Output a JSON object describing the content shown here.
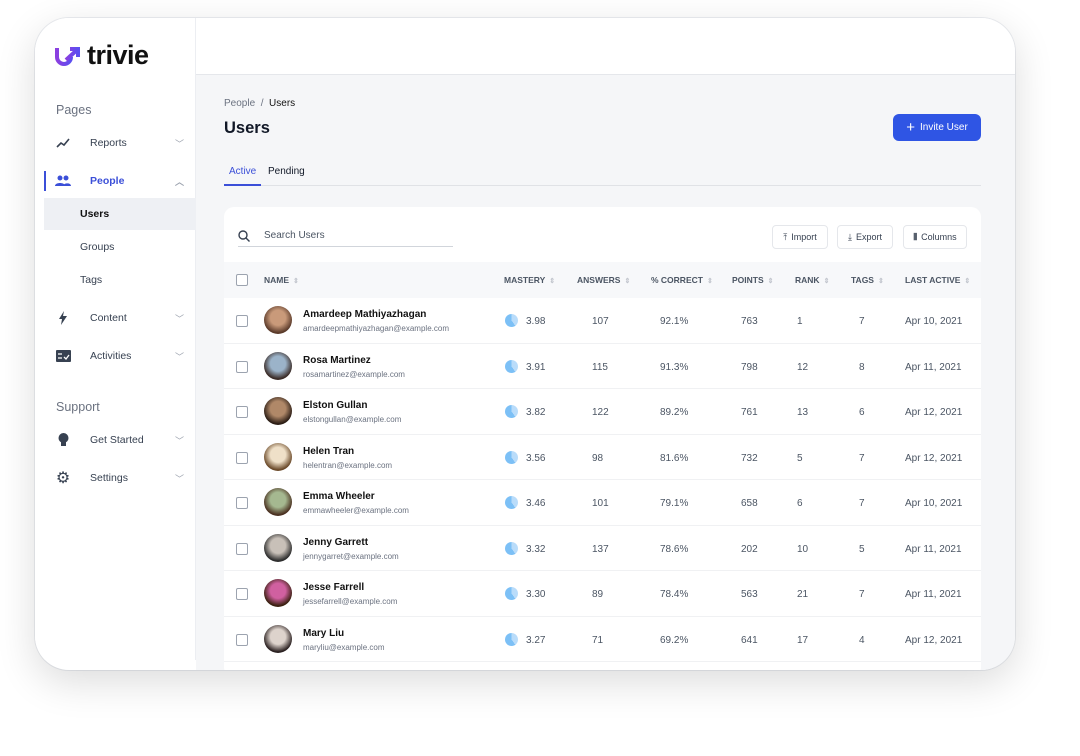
{
  "brand": {
    "name": "trivie",
    "accent": "#2f55e4"
  },
  "sidebar": {
    "pages_label": "Pages",
    "support_label": "Support",
    "items": [
      {
        "label": "Reports",
        "icon": "trending-up-icon"
      },
      {
        "label": "People",
        "icon": "people-icon",
        "expanded": true,
        "sub": [
          "Users",
          "Groups",
          "Tags"
        ],
        "selected_sub": "Users"
      },
      {
        "label": "Content",
        "icon": "lightning-icon"
      },
      {
        "label": "Activities",
        "icon": "activities-icon"
      }
    ],
    "support_items": [
      {
        "label": "Get Started",
        "icon": "lightbulb-icon"
      },
      {
        "label": "Settings",
        "icon": "gear-icon"
      }
    ]
  },
  "breadcrumb": {
    "parent": "People",
    "current": "Users"
  },
  "page_title": "Users",
  "invite_label": "Invite User",
  "tabs": [
    "Active",
    "Pending"
  ],
  "search": {
    "placeholder": "Search Users"
  },
  "toolbar": {
    "import": "Import",
    "export": "Export",
    "columns": "Columns"
  },
  "columns": [
    "NAME",
    "MASTERY",
    "ANSWERS",
    "% CORRECT",
    "POINTS",
    "RANK",
    "TAGS",
    "LAST ACTIVE"
  ],
  "rows": [
    {
      "name": "Amardeep Mathiyazhagan",
      "email": "amardeepmathiyazhagan@example.com",
      "mastery": "3.98",
      "answers": "107",
      "correct": "92.1%",
      "points": "763",
      "rank": "1",
      "tags": "7",
      "last": "Apr 10, 2021"
    },
    {
      "name": "Rosa Martinez",
      "email": "rosamartinez@example.com",
      "mastery": "3.91",
      "answers": "115",
      "correct": "91.3%",
      "points": "798",
      "rank": "12",
      "tags": "8",
      "last": "Apr 11, 2021"
    },
    {
      "name": "Elston Gullan",
      "email": "elstongullan@example.com",
      "mastery": "3.82",
      "answers": "122",
      "correct": "89.2%",
      "points": "761",
      "rank": "13",
      "tags": "6",
      "last": "Apr 12, 2021"
    },
    {
      "name": "Helen Tran",
      "email": "helentran@example.com",
      "mastery": "3.56",
      "answers": "98",
      "correct": "81.6%",
      "points": "732",
      "rank": "5",
      "tags": "7",
      "last": "Apr 12, 2021"
    },
    {
      "name": "Emma Wheeler",
      "email": "emmawheeler@example.com",
      "mastery": "3.46",
      "answers": "101",
      "correct": "79.1%",
      "points": "658",
      "rank": "6",
      "tags": "7",
      "last": "Apr 10, 2021"
    },
    {
      "name": "Jenny Garrett",
      "email": "jennygarret@example.com",
      "mastery": "3.32",
      "answers": "137",
      "correct": "78.6%",
      "points": "202",
      "rank": "10",
      "tags": "5",
      "last": "Apr 11, 2021"
    },
    {
      "name": "Jesse Farrell",
      "email": "jessefarrell@example.com",
      "mastery": "3.30",
      "answers": "89",
      "correct": "78.4%",
      "points": "563",
      "rank": "21",
      "tags": "7",
      "last": "Apr 11, 2021"
    },
    {
      "name": "Mary Liu",
      "email": "maryliu@example.com",
      "mastery": "3.27",
      "answers": "71",
      "correct": "69.2%",
      "points": "641",
      "rank": "17",
      "tags": "4",
      "last": "Apr 12, 2021"
    }
  ]
}
